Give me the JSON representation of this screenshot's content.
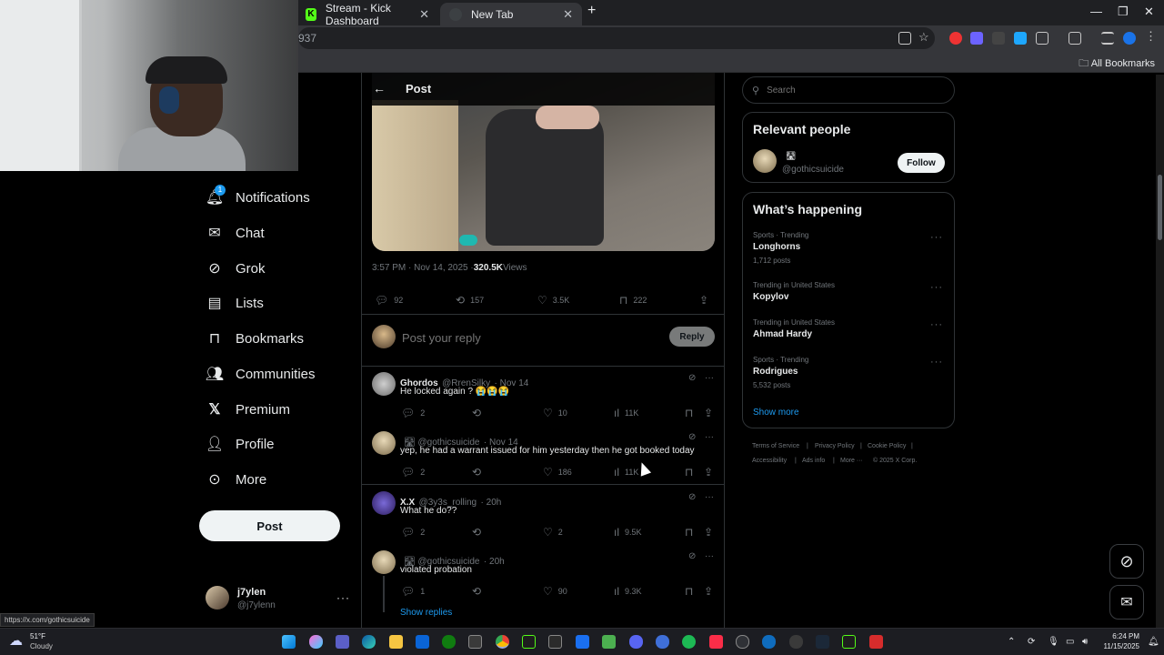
{
  "browser": {
    "tabs": [
      {
        "label": "Stream - Kick Dashboard",
        "favicon": "K"
      },
      {
        "label": "New Tab"
      }
    ],
    "url_fragment": "937",
    "bookmarks_label": "All Bookmarks",
    "status_url": "https://x.com/gothicsuicide"
  },
  "nav": {
    "items": [
      {
        "label": "Notifications",
        "icon": "bell-icon",
        "badge": "1"
      },
      {
        "label": "Chat",
        "icon": "mail-icon"
      },
      {
        "label": "Grok",
        "icon": "grok-icon"
      },
      {
        "label": "Lists",
        "icon": "list-icon"
      },
      {
        "label": "Bookmarks",
        "icon": "bookmark-icon"
      },
      {
        "label": "Communities",
        "icon": "people-icon"
      },
      {
        "label": "Premium",
        "icon": "x-icon"
      },
      {
        "label": "Profile",
        "icon": "person-icon"
      },
      {
        "label": "More",
        "icon": "more-circle-icon"
      }
    ],
    "post_label": "Post",
    "account": {
      "name": "j7ylen",
      "handle": "@j7ylenn"
    }
  },
  "post": {
    "header_title": "Post",
    "timestamp": "3:57 PM · Nov 14, 2025 · ",
    "views_count": "320.5K",
    "views_label": " Views",
    "metrics": {
      "replies": "92",
      "reposts": "157",
      "likes": "3.5K",
      "bookmarks": "222"
    },
    "reply_placeholder": "Post your reply",
    "reply_button": "Reply"
  },
  "replies": [
    {
      "name": "Ghordos",
      "handle": "@RrenSilky",
      "time": "· Nov 14",
      "text": "He locked again ? 😭😭😭",
      "replies": "2",
      "reposts": "",
      "likes": "10",
      "views": "11K"
    },
    {
      "name": "",
      "handle": "@gothicsuicide",
      "time": "· Nov 14",
      "text": "yep,  he had a warrant issued for him yesterday then he got booked today",
      "replies": "2",
      "reposts": "",
      "likes": "186",
      "views": "11K"
    },
    {
      "name": "X.X",
      "handle": "@3y3s_rolling",
      "time": "· 20h",
      "text": "What he do??",
      "replies": "2",
      "reposts": "",
      "likes": "2",
      "views": "9.5K"
    },
    {
      "name": "",
      "handle": "@gothicsuicide",
      "time": "· 20h",
      "text": "violated probation",
      "replies": "1",
      "reposts": "",
      "likes": "90",
      "views": "9.3K"
    }
  ],
  "show_replies": "Show replies",
  "right": {
    "search_placeholder": "Search",
    "relevant_title": "Relevant people",
    "relevant_handle": "@gothicsuicide",
    "follow_label": "Follow",
    "happening_title": "What’s happening",
    "trends": [
      {
        "meta": "Sports · Trending",
        "name": "Longhorns",
        "count": "1,712 posts"
      },
      {
        "meta": "Trending in United States",
        "name": "Kopylov",
        "count": ""
      },
      {
        "meta": "Trending in United States",
        "name": "Ahmad Hardy",
        "count": ""
      },
      {
        "meta": "Sports · Trending",
        "name": "Rodrigues",
        "count": "5,532 posts"
      }
    ],
    "show_more": "Show more",
    "footer": [
      "Terms of Service",
      "|",
      "Privacy Policy",
      "|",
      "Cookie Policy",
      "|",
      "Accessibility",
      "|",
      "Ads info",
      "|",
      "More ···",
      "© 2025 X Corp."
    ]
  },
  "taskbar": {
    "weather_temp": "51°F",
    "weather_desc": "Cloudy",
    "time": "6:24 PM",
    "date": "11/15/2025"
  }
}
